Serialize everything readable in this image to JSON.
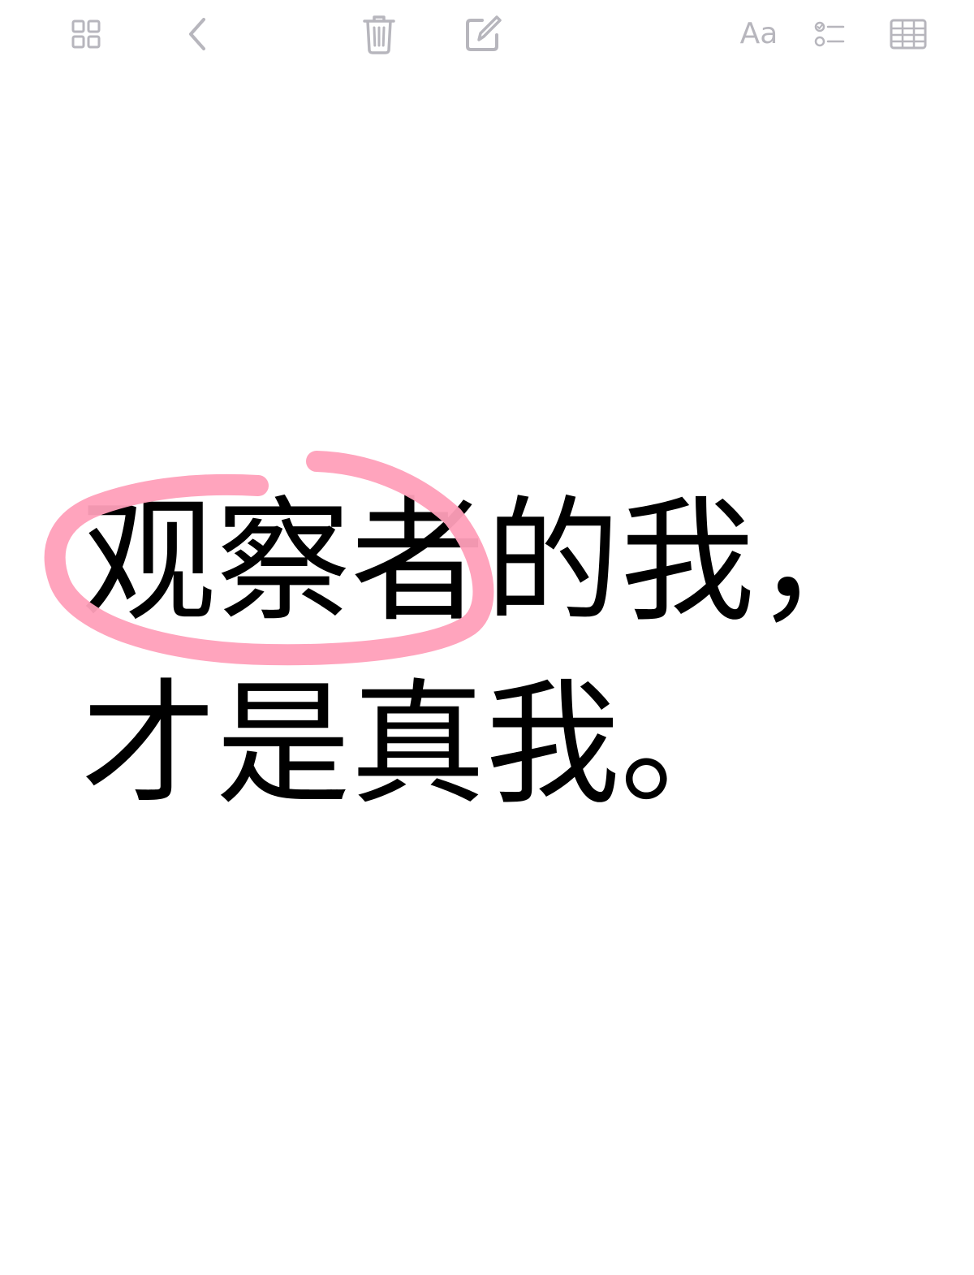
{
  "toolbar": {
    "items": [
      {
        "name": "gallery-icon",
        "label": ""
      },
      {
        "name": "back-chevron-icon",
        "label": ""
      },
      {
        "name": "trash-icon",
        "label": ""
      },
      {
        "name": "compose-icon",
        "label": ""
      },
      {
        "name": "format-text",
        "label": "Aa"
      },
      {
        "name": "checklist-icon",
        "label": ""
      },
      {
        "name": "table-icon",
        "label": ""
      }
    ]
  },
  "note": {
    "line1": "观察者的我，",
    "line2": "才是真我。"
  },
  "colors": {
    "toolbar_icon": "#b7b6bd",
    "text": "#000000",
    "highlight_circle": "#ff9fb9",
    "background": "#ffffff"
  }
}
